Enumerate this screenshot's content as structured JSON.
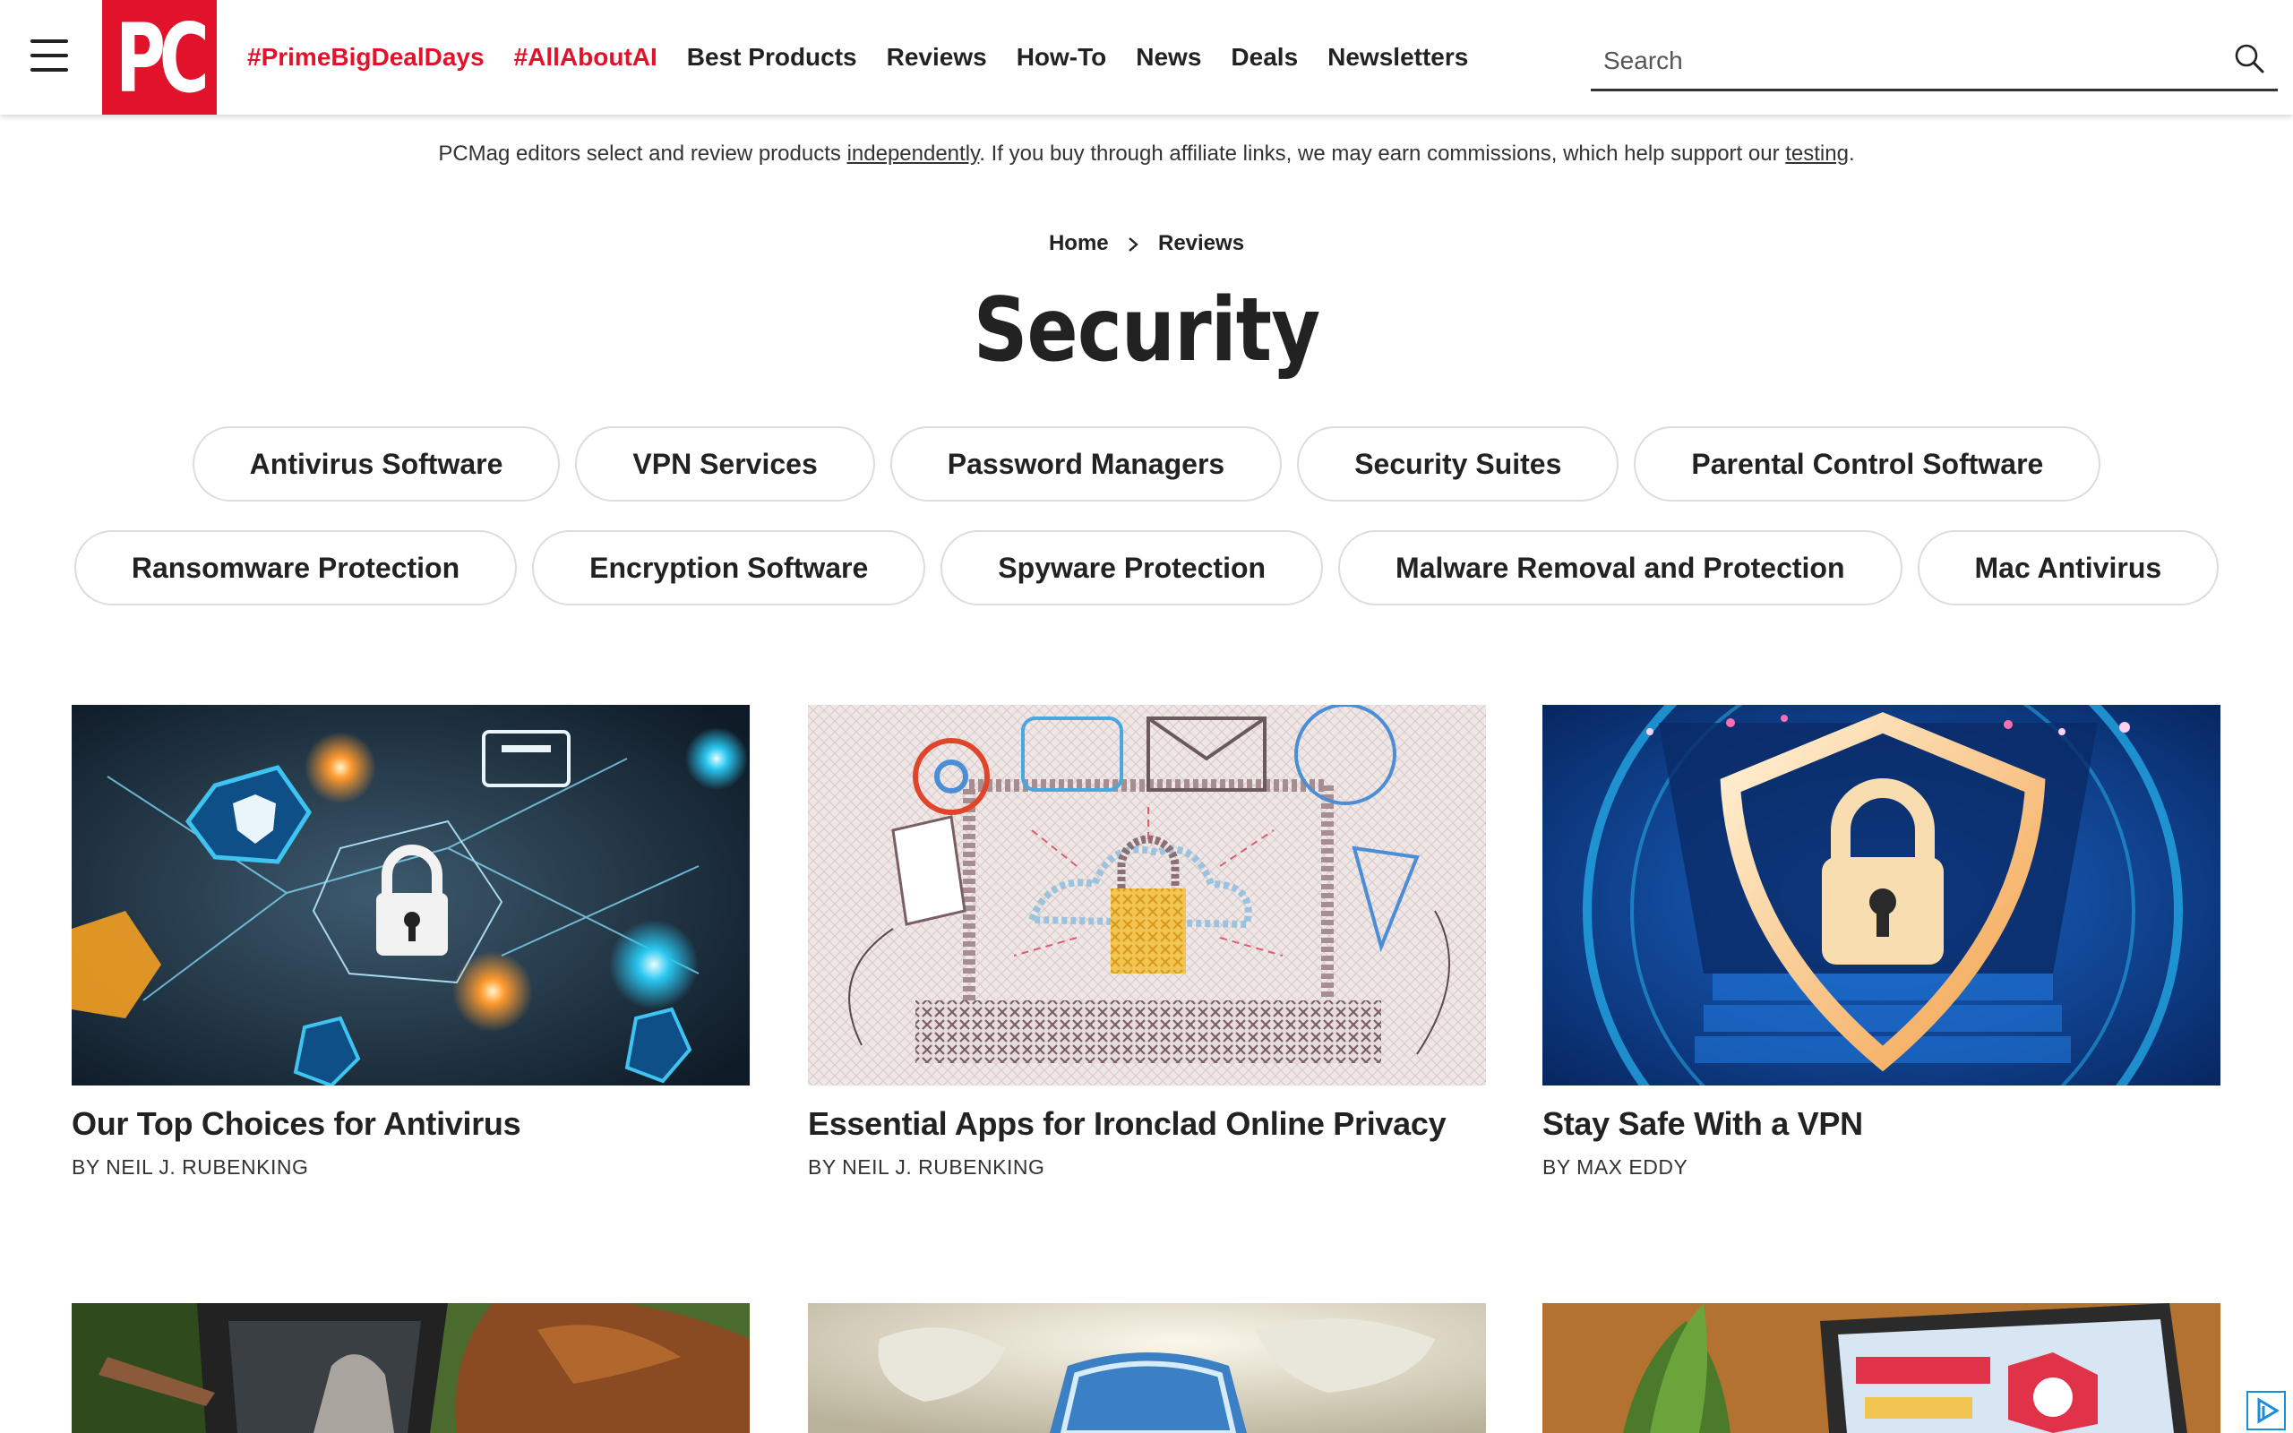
{
  "header": {
    "logo_text": "PC",
    "nav": [
      {
        "label": "#PrimeBigDealDays",
        "highlight": true
      },
      {
        "label": "#AllAboutAI",
        "highlight": true
      },
      {
        "label": "Best Products",
        "highlight": false
      },
      {
        "label": "Reviews",
        "highlight": false
      },
      {
        "label": "How-To",
        "highlight": false
      },
      {
        "label": "News",
        "highlight": false
      },
      {
        "label": "Deals",
        "highlight": false
      },
      {
        "label": "Newsletters",
        "highlight": false
      }
    ],
    "search_placeholder": "Search"
  },
  "disclaimer": {
    "before": "PCMag editors select and review products ",
    "link1": "independently",
    "middle": ". If you buy through affiliate links, we may earn commissions, which help support our ",
    "link2": "testing",
    "after": "."
  },
  "breadcrumb": {
    "home": "Home",
    "current": "Reviews"
  },
  "page_title": "Security",
  "categories_row1": [
    "Antivirus Software",
    "VPN Services",
    "Password Managers",
    "Security Suites",
    "Parental Control Software"
  ],
  "categories_row2": [
    "Ransomware Protection",
    "Encryption Software",
    "Spyware Protection",
    "Malware Removal and Protection",
    "Mac Antivirus"
  ],
  "cards": [
    {
      "title": "Our Top Choices for Antivirus",
      "byline": "BY NEIL J. RUBENKING"
    },
    {
      "title": "Essential Apps for Ironclad Online Privacy",
      "byline": "BY NEIL J. RUBENKING"
    },
    {
      "title": "Stay Safe With a VPN",
      "byline": "BY MAX EDDY"
    }
  ],
  "colors": {
    "brand_red": "#e2122a",
    "text": "#222222",
    "pill_border": "#dddddd"
  },
  "icons": [
    "menu-icon",
    "search-icon",
    "chevron-right-icon",
    "ad-choices-icon"
  ]
}
